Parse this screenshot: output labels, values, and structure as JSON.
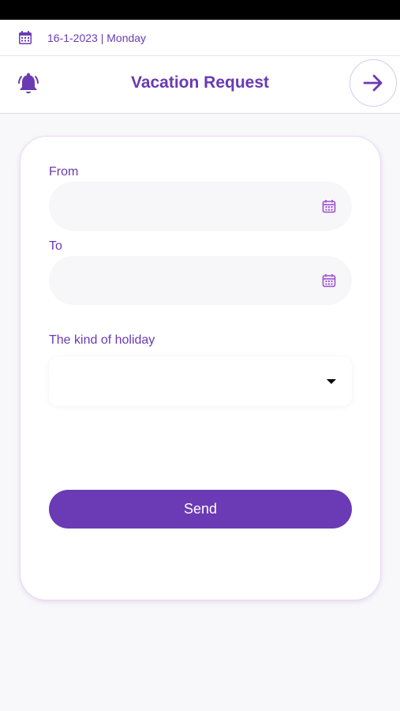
{
  "date_bar": {
    "text": "16-1-2023 | Monday"
  },
  "header": {
    "title": "Vacation Request"
  },
  "form": {
    "from_label": "From",
    "from_value": "",
    "to_label": "To",
    "to_value": "",
    "holiday_label": "The kind of holiday",
    "holiday_value": "",
    "send_label": "Send"
  },
  "colors": {
    "accent": "#6a3ab3",
    "button": "#6b3ab5",
    "field_bg": "#f7f6f8",
    "background": "#f8f7f9"
  },
  "icons": {
    "date_bar": "calendar-icon",
    "header_left": "bell-icon",
    "header_right": "arrow-right-icon",
    "date_fields": "calendar-icon",
    "dropdown": "caret-down-icon"
  }
}
